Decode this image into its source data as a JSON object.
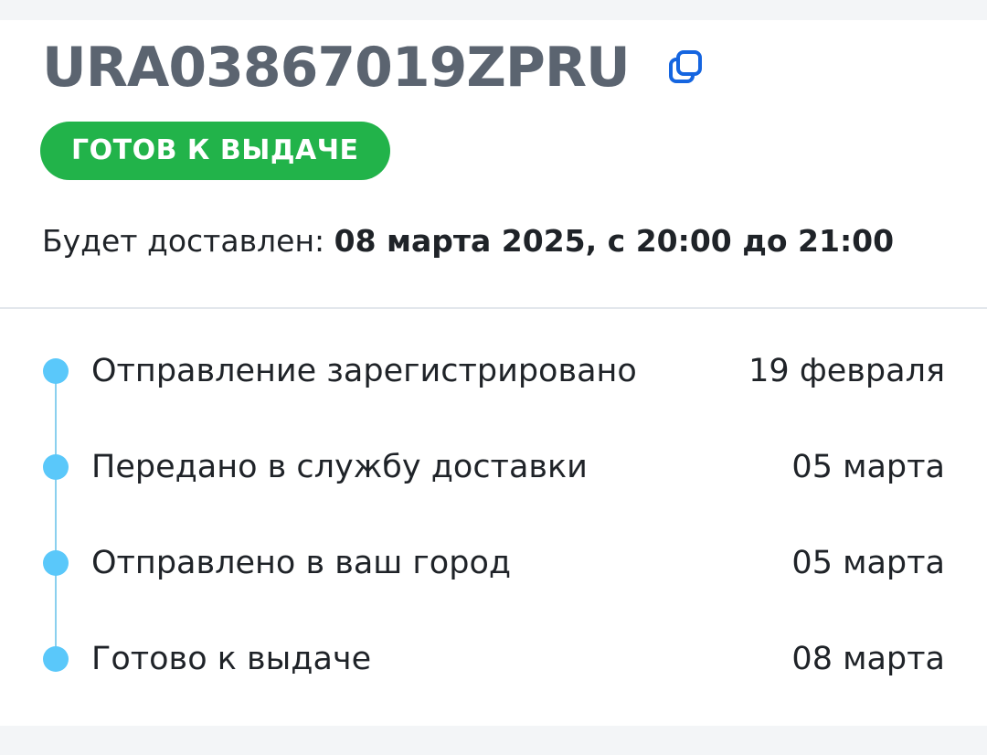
{
  "shipment": {
    "tracking_number": "URA03867019ZPRU",
    "status_badge": "ГОТОВ К ВЫДАЧЕ",
    "delivery_label": "Будет доставлен: ",
    "delivery_value": "08 марта 2025, с 20:00 до 21:00"
  },
  "icons": {
    "copy": "copy-icon",
    "accent_color": "#1565e0"
  },
  "colors": {
    "status": "#22b34a",
    "timeline": "#5ac8fa"
  },
  "timeline": [
    {
      "label": "Отправление зарегистрировано",
      "date": "19 февраля"
    },
    {
      "label": "Передано в службу доставки",
      "date": "05 марта"
    },
    {
      "label": "Отправлено в ваш город",
      "date": "05 марта"
    },
    {
      "label": "Готово к выдаче",
      "date": "08 марта"
    }
  ]
}
